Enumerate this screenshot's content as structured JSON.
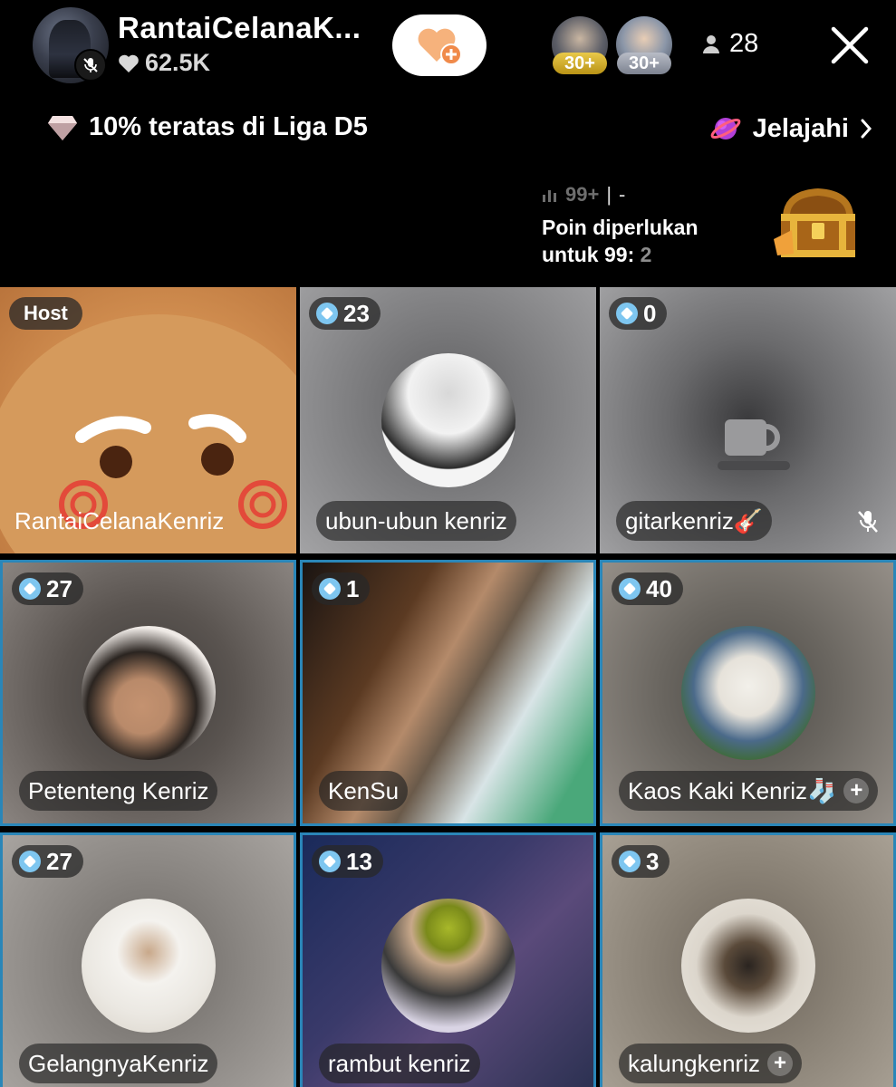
{
  "header": {
    "host_name": "RantaiCelanaK...",
    "likes": "62.5K",
    "viewers": [
      {
        "level": "30+",
        "badge_color": "#d4b12a"
      },
      {
        "level": "30+",
        "badge_color": "#9ba0ab"
      }
    ],
    "viewer_count": "28"
  },
  "league": {
    "text": "10% teratas di Liga D5",
    "explore_label": "Jelajahi"
  },
  "points": {
    "rank": "99+",
    "separator": "|",
    "rank_value": "-",
    "need_line1": "Poin diperlukan",
    "need_line2": "untuk 99:",
    "need_value": "2"
  },
  "grid": {
    "host_badge": "Host",
    "tiles": [
      {
        "name": "RantaiCelanaKenriz"
      },
      {
        "score": "23",
        "name": "ubun-ubun kenriz"
      },
      {
        "score": "0",
        "name": "gitarkenriz🎸"
      },
      {
        "score": "27",
        "name": "Petenteng Kenriz"
      },
      {
        "score": "1",
        "name": "KenSu"
      },
      {
        "score": "40",
        "name": "Kaos Kaki Kenriz🧦"
      },
      {
        "score": "27",
        "name": "GelangnyaKenriz"
      },
      {
        "score": "13",
        "name": "rambut kenriz"
      },
      {
        "score": "3",
        "name": "kalungkenriz"
      }
    ]
  },
  "colors": {
    "accent_border": "#2a86b8",
    "gem": "#7ec6f0",
    "follow_heart": "#f0a070"
  }
}
